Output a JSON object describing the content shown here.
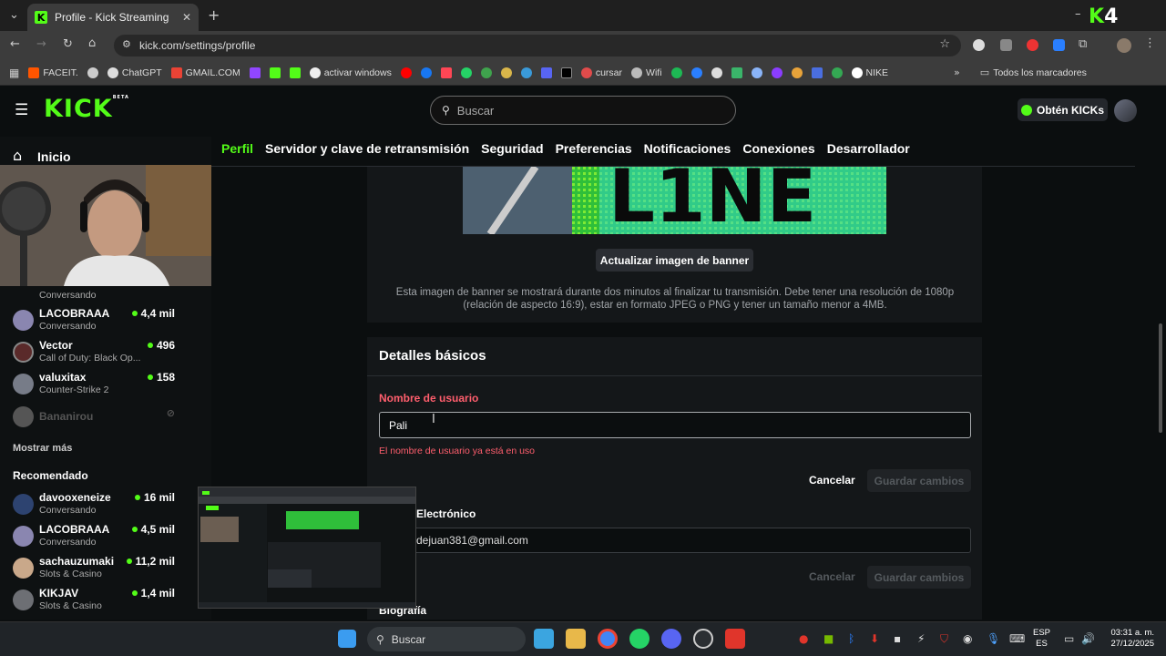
{
  "browser": {
    "tab_title": "Profile - Kick Streaming",
    "url": "kick.com/settings/profile",
    "bookmarks": [
      "FACEIT.",
      "ChatGPT",
      "GMAIL.COM",
      "activar windows",
      "cursar",
      "Wifi",
      "NIKE"
    ],
    "all_bookmarks": "Todos los marcadores",
    "overlay_logo": "K4"
  },
  "header": {
    "logo": "KICK",
    "logo_beta": "BETA",
    "search_placeholder": "Buscar",
    "get_kicks": "Obtén KICKs"
  },
  "sidebar": {
    "home": "Inicio",
    "followed": [
      {
        "name": "",
        "category": "Conversando",
        "viewers": ""
      },
      {
        "name": "LACOBRAAA",
        "category": "Conversando",
        "viewers": "4,4 mil"
      },
      {
        "name": "Vector",
        "category": "Call of Duty: Black Op...",
        "viewers": "496"
      },
      {
        "name": "valuxitax",
        "category": "Counter-Strike 2",
        "viewers": "158"
      },
      {
        "name": "Bananirou",
        "category": "",
        "viewers": ""
      }
    ],
    "show_more": "Mostrar más",
    "recommended_title": "Recomendado",
    "recommended": [
      {
        "name": "davooxeneize",
        "category": "Conversando",
        "viewers": "16 mil"
      },
      {
        "name": "LACOBRAAA",
        "category": "Conversando",
        "viewers": "4,5 mil"
      },
      {
        "name": "sachauzumaki",
        "category": "Slots & Casino",
        "viewers": "11,2 mil"
      },
      {
        "name": "KIKJAV",
        "category": "Slots & Casino",
        "viewers": "1,4 mil"
      }
    ]
  },
  "settings": {
    "tabs": [
      "Perfil",
      "Servidor y clave de retransmisión",
      "Seguridad",
      "Preferencias",
      "Notificaciones",
      "Conexiones",
      "Desarrollador"
    ],
    "banner_text": "L1NE",
    "update_banner": "Actualizar imagen de banner",
    "banner_note": "Esta imagen de banner se mostrará durante dos minutos al finalizar tu transmisión. Debe tener una resolución de 1080p (relación de aspecto 16:9), estar en formato JPEG o PNG y tener un tamaño menor a 4MB.",
    "details_title": "Detalles básicos",
    "username_label": "Nombre de usuario",
    "username_value": "Pali",
    "username_error": "El nombre de usuario ya está en uso",
    "cancel": "Cancelar",
    "save": "Guardar cambios",
    "email_label": "Electrónico",
    "email_value": "dejuan381@gmail.com",
    "bio_label": "Biografía"
  },
  "taskbar": {
    "search": "Buscar",
    "lang_top": "ESP",
    "lang_bottom": "ES",
    "time": "03:31 a. m.",
    "date": "27/12/2025"
  },
  "colors": {
    "kick_green": "#53fc18",
    "error_red": "#ff5e6d",
    "background": "#0b0e0f"
  }
}
